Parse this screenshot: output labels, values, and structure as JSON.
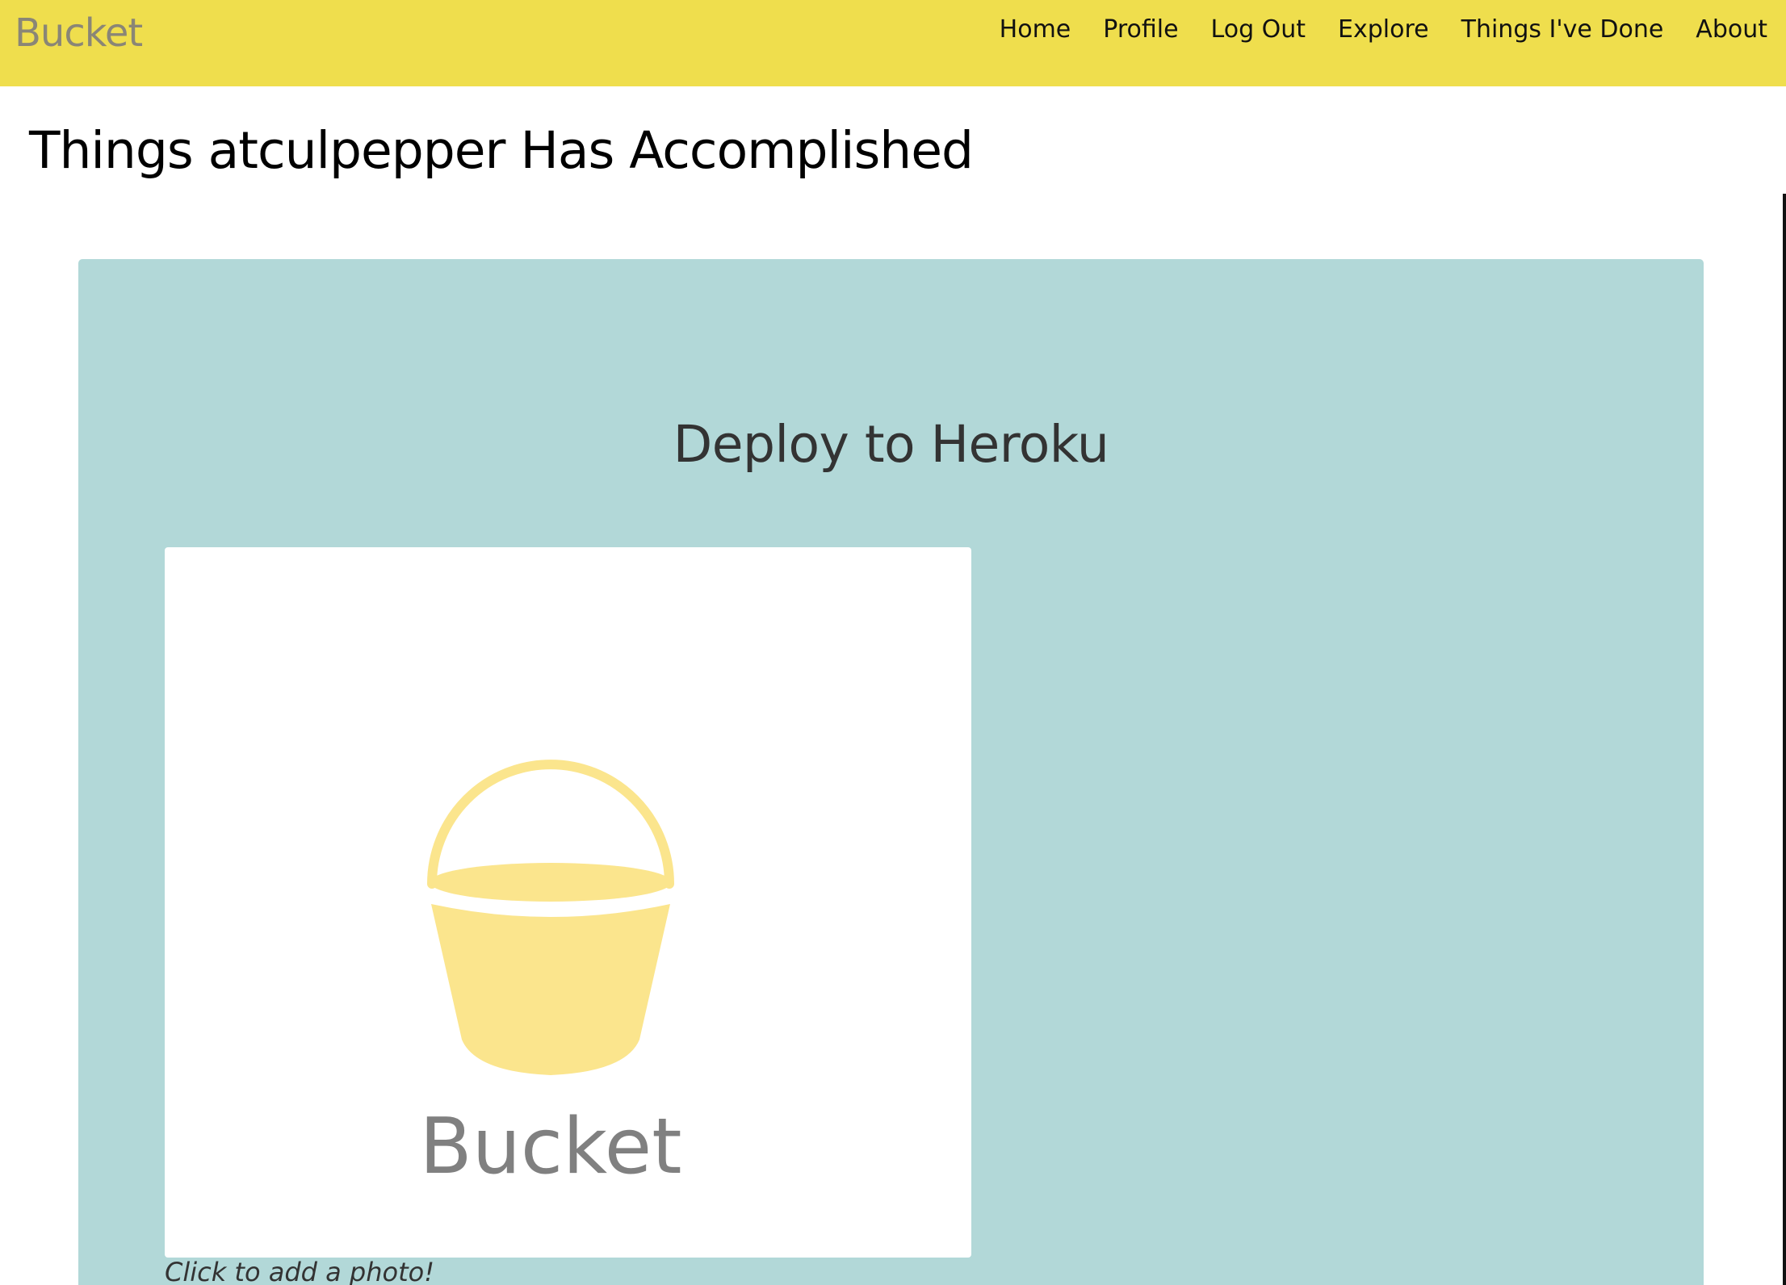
{
  "brand": {
    "name": "Bucket"
  },
  "nav": {
    "items": [
      {
        "label": "Home"
      },
      {
        "label": "Profile"
      },
      {
        "label": "Log Out"
      },
      {
        "label": "Explore"
      },
      {
        "label": "Things I've Done"
      },
      {
        "label": "About"
      }
    ]
  },
  "page": {
    "title": "Things atculpepper Has Accomplished"
  },
  "card": {
    "title": "Deploy to Heroku",
    "placeholder_logo_text": "Bucket",
    "photo_caption": "Click to add a photo!"
  },
  "colors": {
    "navbar": "#efde4d",
    "brand_text": "#8a8676",
    "card_background": "#b2d8d8",
    "bucket_icon": "#fbe58d",
    "logo_text": "#808080"
  },
  "icons": {
    "placeholder": "bucket-icon"
  }
}
